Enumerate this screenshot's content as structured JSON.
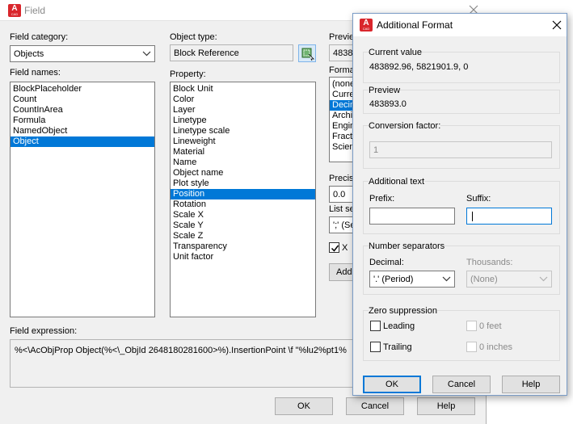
{
  "main": {
    "title": "Field",
    "field_category": {
      "label": "Field category:",
      "value": "Objects"
    },
    "field_names": {
      "label": "Field names:",
      "items": [
        "BlockPlaceholder",
        "Count",
        "CountInArea",
        "Formula",
        "NamedObject",
        "Object"
      ],
      "selected": "Object"
    },
    "object_type": {
      "label": "Object type:",
      "value": "Block Reference"
    },
    "property": {
      "label": "Property:",
      "items": [
        "Block Unit",
        "Color",
        "Layer",
        "Linetype",
        "Linetype scale",
        "Lineweight",
        "Material",
        "Name",
        "Object name",
        "Plot style",
        "Position",
        "Rotation",
        "Scale X",
        "Scale Y",
        "Scale Z",
        "Transparency",
        "Unit factor"
      ],
      "selected": "Position"
    },
    "preview": {
      "label": "Previe",
      "value": "4838"
    },
    "format": {
      "label": "Forma",
      "items": [
        "(none",
        "Curre",
        "Decim",
        "Archit",
        "Engin",
        "Fracti",
        "Scient"
      ],
      "selected": "Decim"
    },
    "precision": {
      "label": "Precis",
      "value": "0.0"
    },
    "list_separator": {
      "label": "List se",
      "value": "';' (Se"
    },
    "x_checkbox": {
      "label": "X",
      "checked": true
    },
    "additional_format_button": "Addi",
    "field_expression": {
      "label": "Field expression:",
      "value": "%<\\AcObjProp Object(%<\\_ObjId 2648180281600>%).InsertionPoint \\f \"%lu2%pt1%"
    },
    "buttons": {
      "ok": "OK",
      "cancel": "Cancel",
      "help": "Help"
    }
  },
  "additional_format": {
    "title": "Additional Format",
    "current_value": {
      "label": "Current value",
      "value": "483892.96, 5821901.9, 0"
    },
    "preview": {
      "label": "Preview",
      "value": "483893.0"
    },
    "conversion_factor": {
      "label": "Conversion factor:",
      "value": "1"
    },
    "additional_text": {
      "label": "Additional text",
      "prefix_label": "Prefix:",
      "prefix_value": "",
      "suffix_label": "Suffix:",
      "suffix_value": ""
    },
    "number_separators": {
      "label": "Number separators",
      "decimal_label": "Decimal:",
      "decimal_value": "'.' (Period)",
      "thousands_label": "Thousands:",
      "thousands_value": "(None)"
    },
    "zero_suppression": {
      "label": "Zero suppression",
      "leading": "Leading",
      "trailing": "Trailing",
      "zero_feet": "0 feet",
      "zero_inches": "0 inches"
    },
    "buttons": {
      "ok": "OK",
      "cancel": "Cancel",
      "help": "Help"
    }
  },
  "icons": {
    "app_icon": "autocad-app-icon",
    "close": "close-icon",
    "dropdown": "chevron-down-icon",
    "pick": "select-object-icon"
  },
  "colors": {
    "accent": "#0078d7",
    "app_red": "#d9262c",
    "selection": "#0078d7"
  }
}
